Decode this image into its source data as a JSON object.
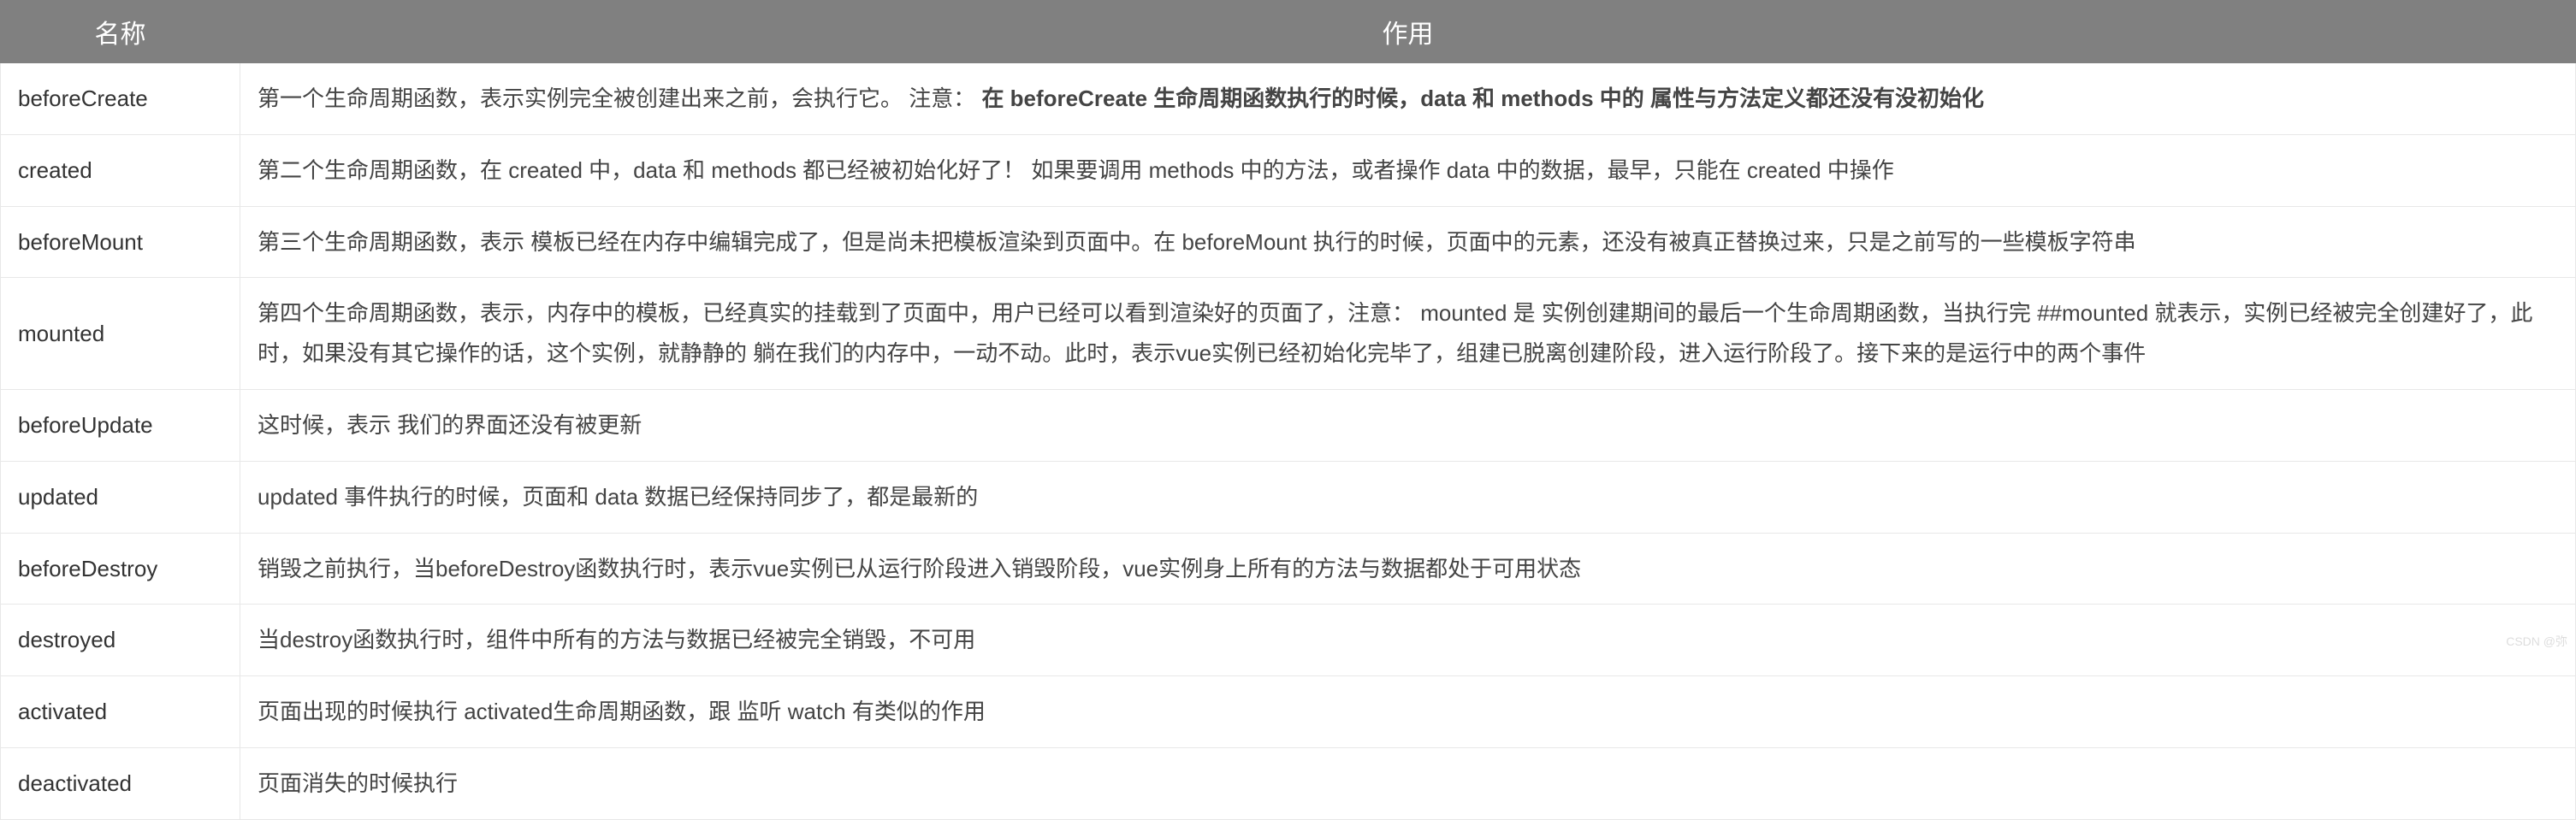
{
  "table": {
    "header": {
      "name": "名称",
      "desc": "作用"
    },
    "rows": [
      {
        "name": "beforeCreate",
        "desc_prefix": "第一个生命周期函数，表示实例完全被创建出来之前，会执行它。 注意： ",
        "desc_bold": "在 beforeCreate 生命周期函数执行的时候，data 和 methods 中的 属性与方法定义都还没有没初始化",
        "desc_suffix": ""
      },
      {
        "name": "created",
        "desc_prefix": "第二个生命周期函数，在 created 中，data 和 methods 都已经被初始化好了！ 如果要调用 methods 中的方法，或者操作 data 中的数据，最早，只能在 created 中操作",
        "desc_bold": "",
        "desc_suffix": ""
      },
      {
        "name": "beforeMount",
        "desc_prefix": "第三个生命周期函数，表示 模板已经在内存中编辑完成了，但是尚未把模板渲染到页面中。在 beforeMount 执行的时候，页面中的元素，还没有被真正替换过来，只是之前写的一些模板字符串",
        "desc_bold": "",
        "desc_suffix": ""
      },
      {
        "name": "mounted",
        "desc_prefix": "第四个生命周期函数，表示，内存中的模板，已经真实的挂载到了页面中，用户已经可以看到渲染好的页面了，注意： mounted 是 实例创建期间的最后一个生命周期函数，当执行完 ##mounted 就表示，实例已经被完全创建好了，此时，如果没有其它操作的话，这个实例，就静静的 躺在我们的内存中，一动不动。此时，表示vue实例已经初始化完毕了，组建已脱离创建阶段，进入运行阶段了。接下来的是运行中的两个事件",
        "desc_bold": "",
        "desc_suffix": ""
      },
      {
        "name": "beforeUpdate",
        "desc_prefix": "这时候，表示 我们的界面还没有被更新",
        "desc_bold": "",
        "desc_suffix": ""
      },
      {
        "name": "updated",
        "desc_prefix": "updated 事件执行的时候，页面和 data 数据已经保持同步了，都是最新的",
        "desc_bold": "",
        "desc_suffix": ""
      },
      {
        "name": "beforeDestroy",
        "desc_prefix": "销毁之前执行，当beforeDestroy函数执行时，表示vue实例已从运行阶段进入销毁阶段，vue实例身上所有的方法与数据都处于可用状态",
        "desc_bold": "",
        "desc_suffix": ""
      },
      {
        "name": "destroyed",
        "desc_prefix": "当destroy函数执行时，组件中所有的方法与数据已经被完全销毁，不可用",
        "desc_bold": "",
        "desc_suffix": ""
      },
      {
        "name": "activated",
        "desc_prefix": "页面出现的时候执行 activated生命周期函数，跟 监听 watch 有类似的作用",
        "desc_bold": "",
        "desc_suffix": ""
      },
      {
        "name": "deactivated",
        "desc_prefix": "页面消失的时候执行",
        "desc_bold": "",
        "desc_suffix": ""
      }
    ]
  },
  "watermark": "CSDN @弥"
}
